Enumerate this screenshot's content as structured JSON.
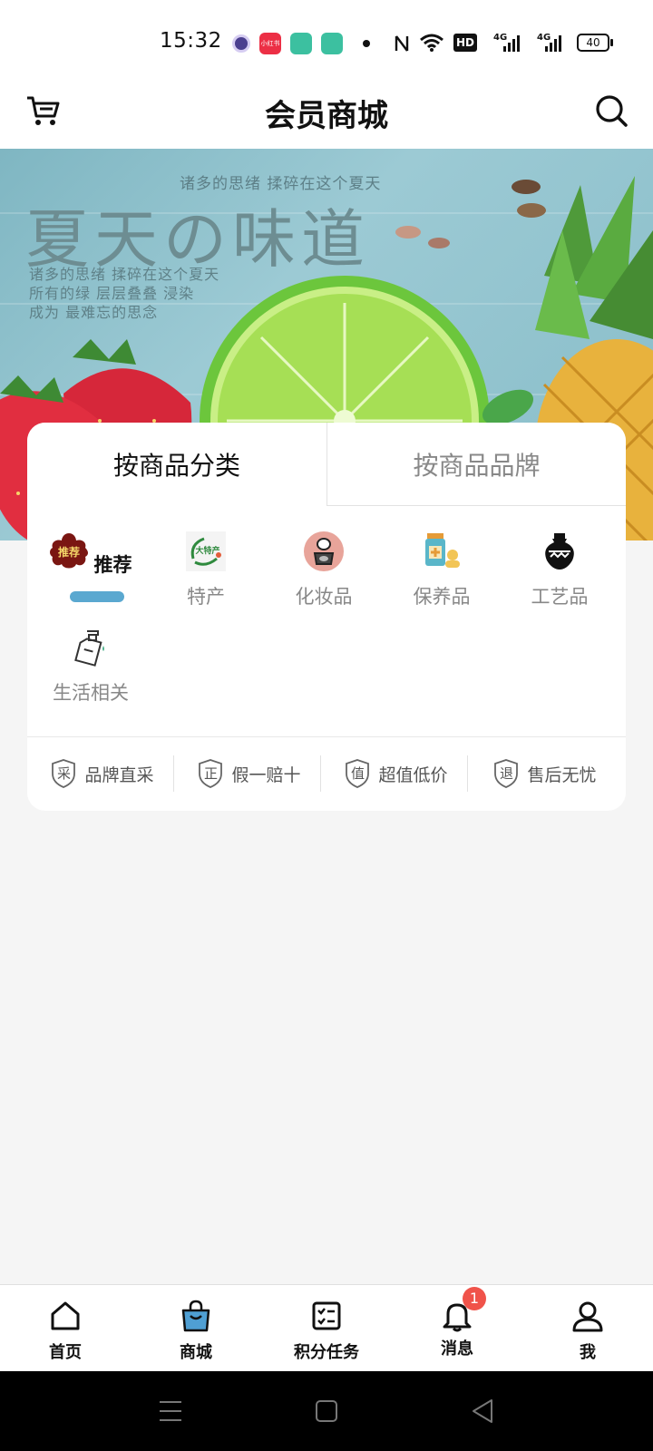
{
  "status_bar": {
    "time": "15:32",
    "hd_label": "HD",
    "net1": "4G",
    "net2": "4G",
    "battery": "40",
    "app_label": "小红书"
  },
  "header": {
    "title": "会员商城",
    "left_icon": "cart-icon",
    "right_icon": "search-icon"
  },
  "banner": {
    "subtitle": "诸多的思绪 揉碎在这个夏天",
    "title": "夏天の味道",
    "poem": [
      "诸多的思绪 揉碎在这个夏天",
      "所有的绿 层层叠叠 浸染",
      "成为 最难忘的思念"
    ]
  },
  "tabs": {
    "by_category": "按商品分类",
    "by_brand": "按商品品牌"
  },
  "categories": [
    {
      "label": "推荐",
      "icon": "recommend-icon",
      "icon_text": "推荐",
      "active": true
    },
    {
      "label": "特产",
      "icon": "specialty-icon",
      "icon_text": "大特产",
      "active": false
    },
    {
      "label": "化妆品",
      "icon": "cosmetics-icon",
      "active": false
    },
    {
      "label": "保养品",
      "icon": "health-supplement-icon",
      "active": false
    },
    {
      "label": "工艺品",
      "icon": "craft-vase-icon",
      "active": false
    },
    {
      "label": "生活相关",
      "icon": "spray-bottle-icon",
      "active": false
    }
  ],
  "guarantees": [
    {
      "badge": "采",
      "label": "品牌直采"
    },
    {
      "badge": "正",
      "label": "假一赔十"
    },
    {
      "badge": "值",
      "label": "超值低价"
    },
    {
      "badge": "退",
      "label": "售后无忧"
    }
  ],
  "tabbar": [
    {
      "label": "首页",
      "icon": "home-icon"
    },
    {
      "label": "商城",
      "icon": "shopping-bag-icon"
    },
    {
      "label": "积分任务",
      "icon": "task-list-icon"
    },
    {
      "label": "消息",
      "icon": "bell-icon",
      "badge": "1"
    },
    {
      "label": "我",
      "icon": "profile-icon"
    }
  ],
  "colors": {
    "accent": "#5aa8d0",
    "badge": "#f0534a",
    "page_bg": "#f5f5f5"
  }
}
